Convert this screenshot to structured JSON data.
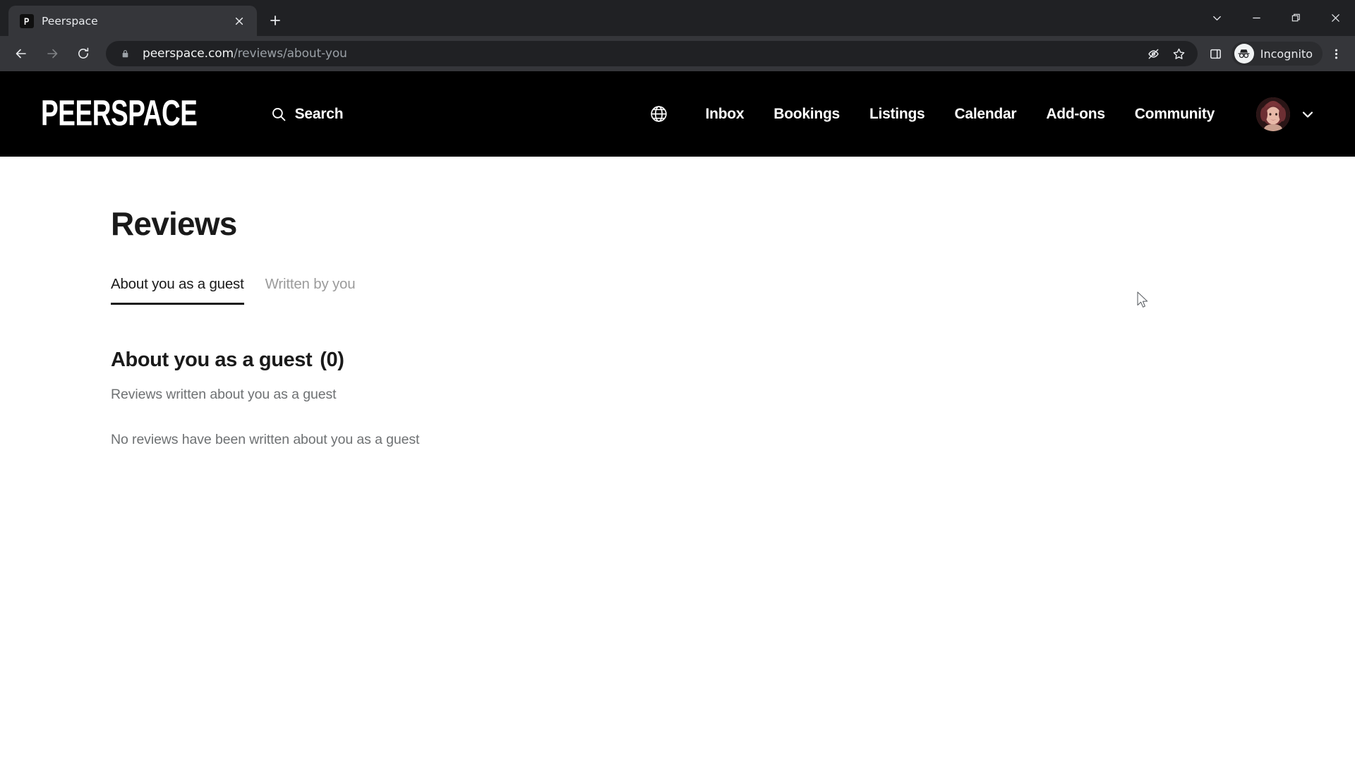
{
  "browser": {
    "tab": {
      "title": "Peerspace",
      "favicon_letter": "P",
      "close_icon": "close-icon"
    },
    "new_tab_icon": "plus-icon",
    "window_controls": {
      "tab_search": "chevron-down-icon",
      "minimize": "minimize-icon",
      "maximize": "restore-icon",
      "close": "close-icon"
    },
    "toolbar": {
      "back_icon": "arrow-left-icon",
      "forward_icon": "arrow-right-icon",
      "reload_icon": "reload-icon",
      "lock_icon": "lock-icon",
      "url_domain": "peerspace.com",
      "url_path": "/reviews/about-you",
      "tracking_protection_icon": "eye-off-icon",
      "bookmark_icon": "star-icon",
      "side_panel_icon": "side-panel-icon",
      "incognito_label": "Incognito",
      "incognito_icon": "incognito-hat-icon",
      "menu_icon": "kebab-menu-icon"
    }
  },
  "site": {
    "brand": "PEERSPACE",
    "search": {
      "label": "Search",
      "icon": "search-icon"
    },
    "language_icon": "globe-icon",
    "nav_items": [
      {
        "label": "Inbox"
      },
      {
        "label": "Bookings"
      },
      {
        "label": "Listings"
      },
      {
        "label": "Calendar"
      },
      {
        "label": "Add-ons"
      },
      {
        "label": "Community"
      }
    ],
    "account": {
      "avatar": "user-avatar",
      "chevron_icon": "chevron-down-icon"
    }
  },
  "page": {
    "title": "Reviews",
    "tabs": [
      {
        "label": "About you as a guest",
        "active": true
      },
      {
        "label": "Written by you",
        "active": false
      }
    ],
    "section": {
      "heading": "About you as a guest",
      "count": "(0)",
      "subtitle": "Reviews written about you as a guest",
      "empty_message": "No reviews have been written about you as a guest"
    }
  },
  "colors": {
    "header_bg": "#000000",
    "page_bg": "#ffffff",
    "text_primary": "#1a1a1a",
    "text_muted": "#6e7173",
    "tab_inactive": "#9b9b9b",
    "chrome_tabstrip": "#202124",
    "chrome_toolbar": "#35363a"
  }
}
